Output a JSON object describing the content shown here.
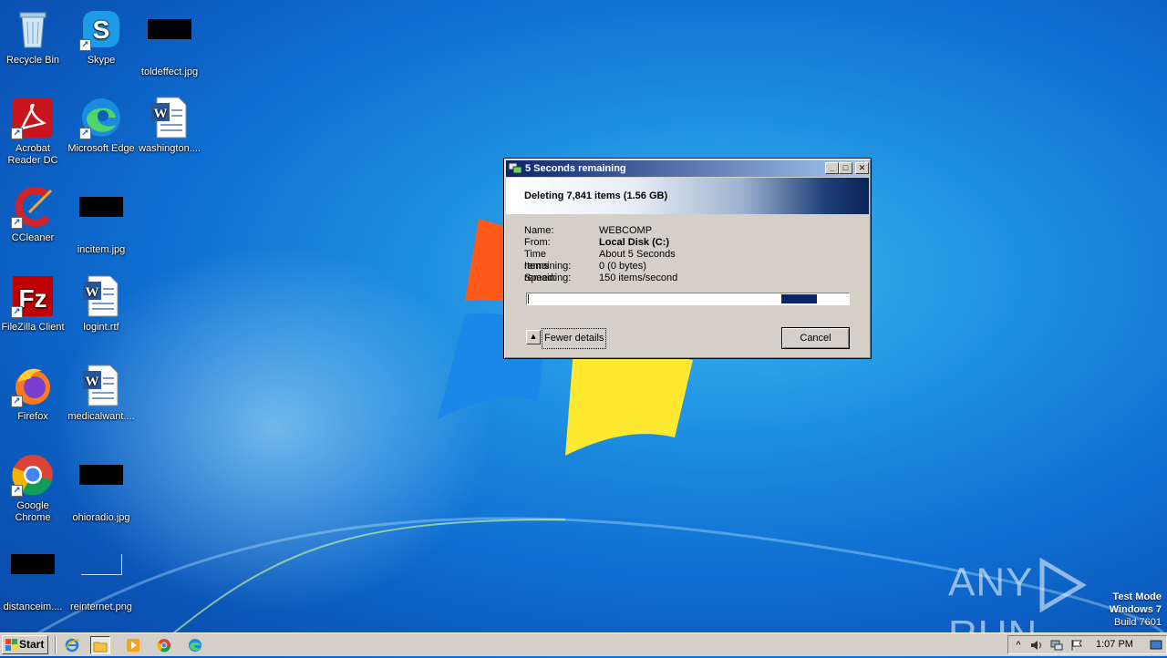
{
  "desktop": {
    "icons": [
      {
        "label": "Recycle Bin"
      },
      {
        "label": "Skype"
      },
      {
        "label": "toldeffect.jpg"
      },
      {
        "label": "Acrobat Reader DC"
      },
      {
        "label": "Microsoft Edge"
      },
      {
        "label": "washington...."
      },
      {
        "label": "CCleaner"
      },
      {
        "label": "incitem.jpg"
      },
      {
        "label": "FileZilla Client"
      },
      {
        "label": "logint.rtf"
      },
      {
        "label": "Firefox"
      },
      {
        "label": "medicalwant...."
      },
      {
        "label": "Google Chrome"
      },
      {
        "label": "ohioradio.jpg"
      },
      {
        "label": "distanceim...."
      },
      {
        "label": "reinternet.png"
      }
    ]
  },
  "dialog": {
    "title": "5 Seconds remaining",
    "header": "Deleting 7,841 items (1.56 GB)",
    "details": [
      {
        "label": "Name:",
        "value": "WEBCOMP"
      },
      {
        "label": "From:",
        "value": "Local Disk (C:)"
      },
      {
        "label": "Time remaining:",
        "value": "About 5 Seconds"
      },
      {
        "label": "Items remaining:",
        "value": "0 (0 bytes)"
      },
      {
        "label": "Speed:",
        "value": "150 items/second"
      }
    ],
    "progress_fraction": 0.9,
    "fewer_details_label": "Fewer details",
    "cancel_label": "Cancel",
    "minimize_glyph": "_",
    "maximize_glyph": "□",
    "close_glyph": "✕",
    "fewer_arrow_glyph": "▲"
  },
  "watermark": {
    "text_left": "ANY",
    "text_right": "RUN"
  },
  "test_mode": {
    "line1": "Test Mode",
    "line2": "Windows 7",
    "line3": "Build 7601"
  },
  "taskbar": {
    "start_label": "Start",
    "clock": "1:07 PM",
    "tray_arrow": "^"
  },
  "colors": {
    "title_gradient_start": "#0a246a",
    "title_gradient_end": "#a6caf0",
    "progress_fill": "#0a246a",
    "dialog_face": "#d4d0c8"
  }
}
